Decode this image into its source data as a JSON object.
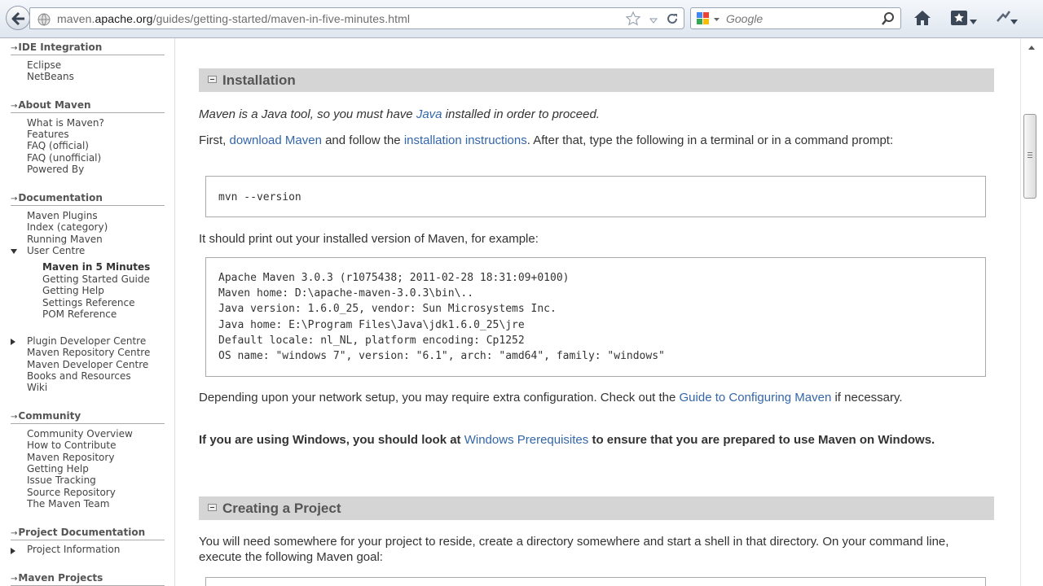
{
  "browser": {
    "url_prefix": "maven.",
    "url_domain": "apache.org",
    "url_path": "/guides/getting-started/maven-in-five-minutes.html",
    "search_placeholder": "Google"
  },
  "sidebar": {
    "ide_integration": {
      "title": "IDE Integration",
      "items": [
        "Eclipse",
        "NetBeans"
      ]
    },
    "about_maven": {
      "title": "About Maven",
      "items": [
        "What is Maven?",
        "Features",
        "FAQ (official)",
        "FAQ (unofficial)",
        "Powered By"
      ]
    },
    "documentation": {
      "title": "Documentation",
      "items": [
        "Maven Plugins",
        "Index (category)",
        "Running Maven"
      ],
      "user_centre": "User Centre",
      "user_centre_items": [
        "Maven in 5 Minutes",
        "Getting Started Guide",
        "Getting Help",
        "Settings Reference",
        "POM Reference"
      ],
      "more_items": [
        "Plugin Developer Centre",
        "Maven Repository Centre",
        "Maven Developer Centre",
        "Books and Resources",
        "Wiki"
      ]
    },
    "community": {
      "title": "Community",
      "items": [
        "Community Overview",
        "How to Contribute",
        "Maven Repository",
        "Getting Help",
        "Issue Tracking",
        "Source Repository",
        "The Maven Team"
      ]
    },
    "project_documentation": {
      "title": "Project Documentation",
      "items": [
        "Project Information"
      ]
    },
    "maven_projects": {
      "title": "Maven Projects"
    }
  },
  "main": {
    "installation": {
      "heading": "Installation",
      "intro_a": "Maven is a Java tool, so you must have ",
      "intro_link": "Java",
      "intro_b": " installed in order to proceed.",
      "first_a": "First, ",
      "first_link1": "download Maven",
      "first_b": " and follow the ",
      "first_link2": "installation instructions",
      "first_c": ". After that, type the following in a terminal or in a command prompt:",
      "command": "mvn --version",
      "print_text": "It should print out your installed version of Maven, for example:",
      "output": "Apache Maven 3.0.3 (r1075438; 2011-02-28 18:31:09+0100)\nMaven home: D:\\apache-maven-3.0.3\\bin\\..\nJava version: 1.6.0_25, vendor: Sun Microsystems Inc.\nJava home: E:\\Program Files\\Java\\jdk1.6.0_25\\jre\nDefault locale: nl_NL, platform encoding: Cp1252\nOS name: \"windows 7\", version: \"6.1\", arch: \"amd64\", family: \"windows\"",
      "network_a": "Depending upon your network setup, you may require extra configuration. Check out the ",
      "network_link": "Guide to Configuring Maven",
      "network_b": " if necessary.",
      "windows_a": "If you are using Windows, you should look at ",
      "windows_link": "Windows Prerequisites",
      "windows_b": " to ensure that you are prepared to use Maven on Windows."
    },
    "creating": {
      "heading": "Creating a Project",
      "text": "You will need somewhere for your project to reside, create a directory somewhere and start a shell in that directory. On your command line, execute the following Maven goal:"
    }
  },
  "colors": {
    "link": "#3366aa",
    "section_bg": "#d5d5d5",
    "text": "#333333"
  }
}
